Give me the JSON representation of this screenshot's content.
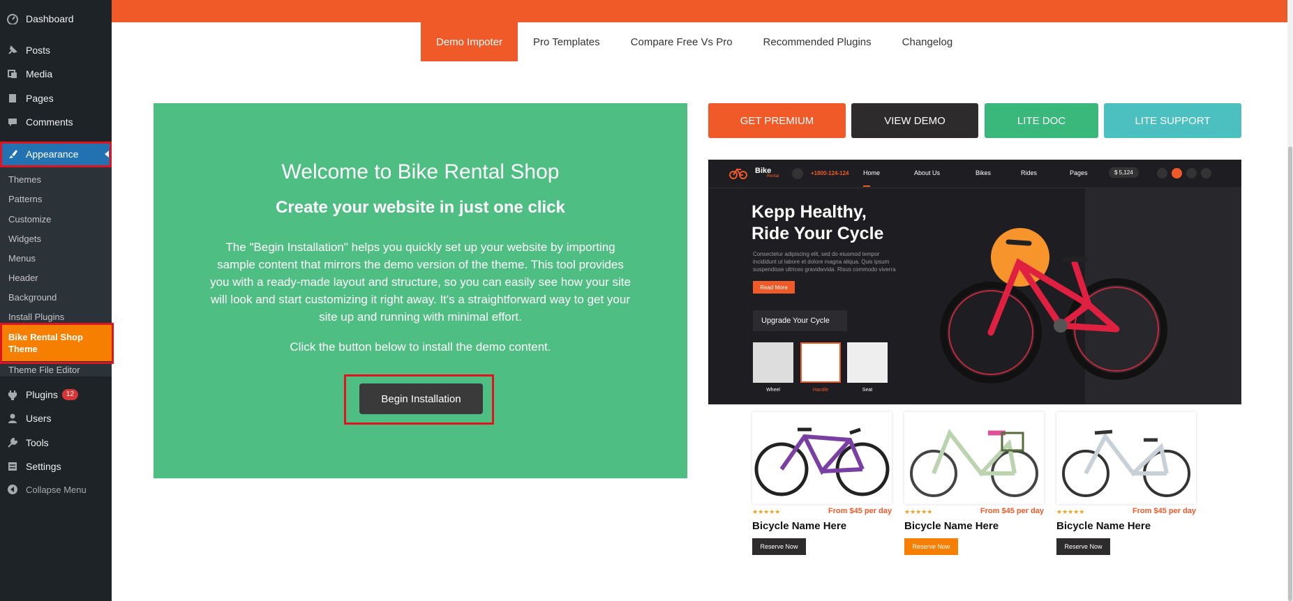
{
  "sidebar": {
    "dashboard": "Dashboard",
    "posts": "Posts",
    "media": "Media",
    "pages": "Pages",
    "comments": "Comments",
    "appearance": "Appearance",
    "submenu": [
      "Themes",
      "Patterns",
      "Customize",
      "Widgets",
      "Menus",
      "Header",
      "Background",
      "Install Plugins"
    ],
    "bike_theme": "Bike Rental Shop Theme",
    "theme_file_editor": "Theme File Editor",
    "plugins": "Plugins",
    "plugins_badge": "12",
    "users": "Users",
    "tools": "Tools",
    "settings": "Settings",
    "collapse": "Collapse Menu"
  },
  "tabs": [
    "Demo Impoter",
    "Pro Templates",
    "Compare Free Vs Pro",
    "Recommended Plugins",
    "Changelog"
  ],
  "welcome": {
    "title": "Welcome to Bike Rental Shop",
    "subtitle": "Create your website in just one click",
    "description": "The \"Begin Installation\" helps you quickly set up your website by importing sample content that mirrors the demo version of the theme. This tool provides you with a ready-made layout and structure, so you can easily see how your site will look and start customizing it right away. It's a straightforward way to get your site up and running with minimal effort.",
    "click_text": "Click the button below to install the demo content.",
    "begin_button": "Begin Installation"
  },
  "actions": {
    "get_premium": "GET PREMIUM",
    "view_demo": "VIEW DEMO",
    "lite_doc": "LITE DOC",
    "lite_support": "LITE SUPPORT"
  },
  "preview": {
    "logo": "Bike",
    "logo_sub": "Rental",
    "phone": "+1800-124-124",
    "nav": [
      "Home",
      "About Us",
      "Bikes",
      "Rides",
      "Pages"
    ],
    "cart": "$ 5,124",
    "hero_line1": "Kepp Healthy,",
    "hero_line2": "Ride Your Cycle",
    "hero_text": "Consectetur adipiscing elit, sed do eiusmod tempor incididunt ut labore et dolore magna aliqua. Quis ipsum suspendisse ultrices gravidwvida. Risus commodo viverra",
    "read_more": "Read More",
    "upgrade": "Upgrade Your Cycle",
    "thumbs": [
      "Wheel",
      "Handle",
      "Seat"
    ]
  },
  "products": [
    {
      "name": "Bicycle Name Here",
      "price": "From $45 per day",
      "reserve": "Reserve Now",
      "stars": "★★★★★"
    },
    {
      "name": "Bicycle Name Here",
      "price": "From $45 per day",
      "reserve": "Reserve Now",
      "stars": "★★★★★"
    },
    {
      "name": "Bicycle Name Here",
      "price": "From $45 per day",
      "reserve": "Reserve Now",
      "stars": "★★★★★"
    }
  ],
  "colors": {
    "accent": "#f05a28",
    "green": "#4fbe82",
    "teal": "#4cc0c0",
    "sidebar": "#1d2327",
    "highlight": "#f77f00"
  }
}
